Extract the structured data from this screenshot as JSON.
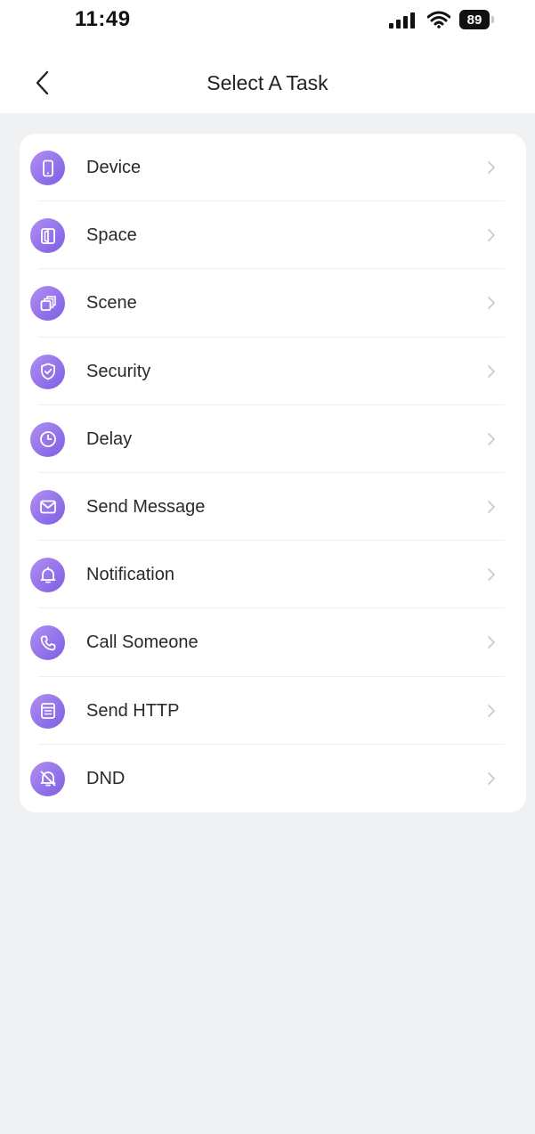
{
  "status": {
    "time": "11:49",
    "battery": "89"
  },
  "header": {
    "title": "Select A Task"
  },
  "tasks": [
    {
      "label": "Device",
      "icon": "phone-device-icon"
    },
    {
      "label": "Space",
      "icon": "door-icon"
    },
    {
      "label": "Scene",
      "icon": "layers-icon"
    },
    {
      "label": "Security",
      "icon": "shield-icon"
    },
    {
      "label": "Delay",
      "icon": "clock-icon"
    },
    {
      "label": "Send Message",
      "icon": "envelope-icon"
    },
    {
      "label": "Notification",
      "icon": "bell-icon"
    },
    {
      "label": "Call Someone",
      "icon": "phone-call-icon"
    },
    {
      "label": "Send HTTP",
      "icon": "document-icon"
    },
    {
      "label": "DND",
      "icon": "bell-off-icon"
    }
  ],
  "colors": {
    "icon_gradient_start": "#b08ff2",
    "icon_gradient_end": "#7d5ee2",
    "page_background": "#f0f1f3",
    "card_background": "#ffffff"
  }
}
